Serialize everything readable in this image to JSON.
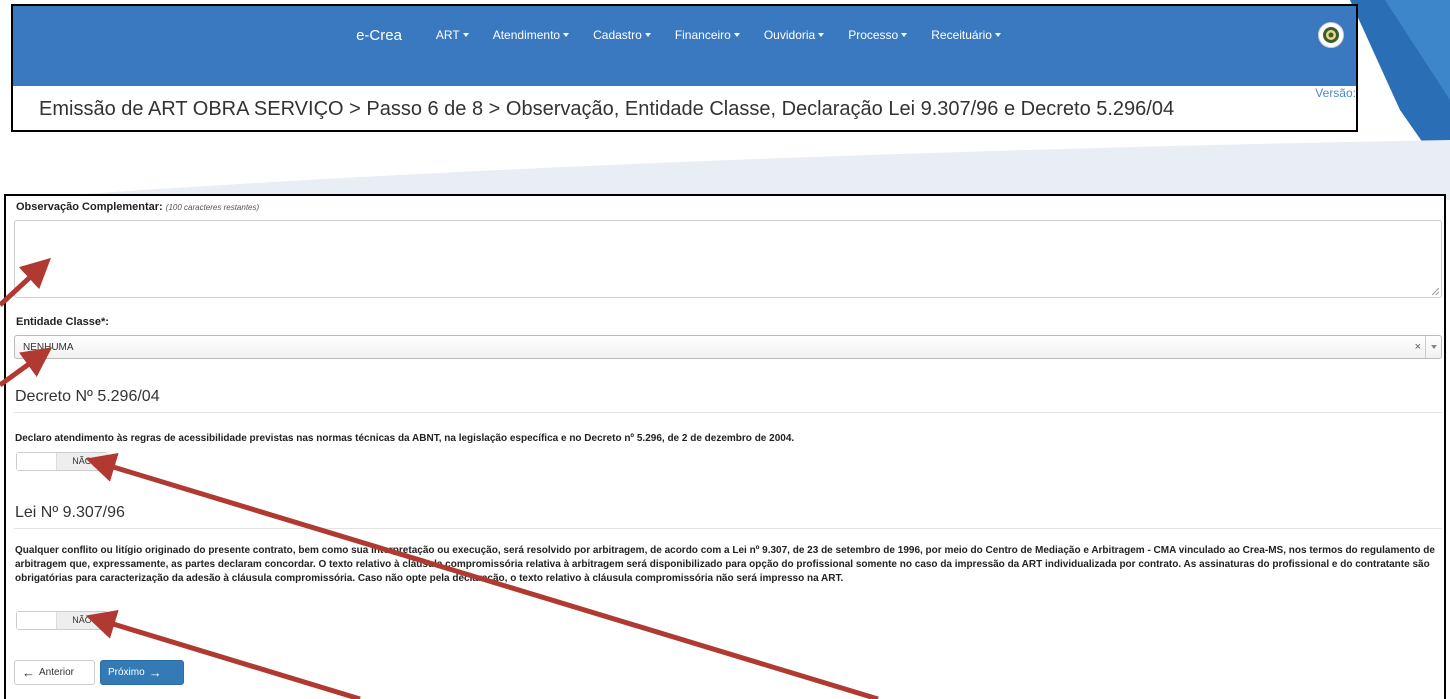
{
  "nav": {
    "brand": "e-Crea",
    "items": [
      "ART",
      "Atendimento",
      "Cadastro",
      "Financeiro",
      "Ouvidoria",
      "Processo",
      "Receituário"
    ]
  },
  "header": {
    "version_label": "Versão:",
    "breadcrumb": "Emissão de ART OBRA SERVIÇO > Passo 6 de 8 > Observação, Entidade Classe, Declaração Lei 9.307/96 e Decreto 5.296/04"
  },
  "form": {
    "obs_label": "Observação Complementar:",
    "obs_hint": "(100 caracteres restantes)",
    "obs_value": "",
    "entidade_label": "Entidade Classe*:",
    "entidade_value": "NENHUMA",
    "entidade_clear": "×",
    "decreto_title": "Decreto Nº 5.296/04",
    "decreto_text": "Declaro atendimento às regras de acessibilidade previstas nas normas técnicas da ABNT, na legislação específica e no Decreto nº 5.296, de 2 de dezembro de 2004.",
    "decreto_toggle": "NÃO",
    "lei_title": "Lei Nº 9.307/96",
    "lei_text": "Qualquer conflito ou litígio originado do presente contrato, bem como sua interpretação ou execução, será resolvido por arbitragem, de acordo com a Lei nº 9.307, de 23 de setembro de 1996, por meio do Centro de Mediação e Arbitragem - CMA vinculado ao Crea-MS, nos termos do regulamento de arbitragem que, expressamente, as partes declaram concordar. O texto relativo à cláusula compromissória relativa à arbitragem será disponibilizado para opção do profissional somente no caso da impressão da ART individualizada por contrato. As assinaturas do profissional e do contratante são obrigatórias para caracterização da adesão à cláusula compromissória. Caso não opte pela declaração, o texto relativo à cláusula compromissória não será impresso na ART.",
    "lei_toggle": "NÃO",
    "prev_label": "Anterior",
    "next_label": "Próximo"
  },
  "colors": {
    "navbar": "#3a78c0",
    "primary_button": "#337ab7",
    "annotation_arrow": "#b03a32"
  }
}
